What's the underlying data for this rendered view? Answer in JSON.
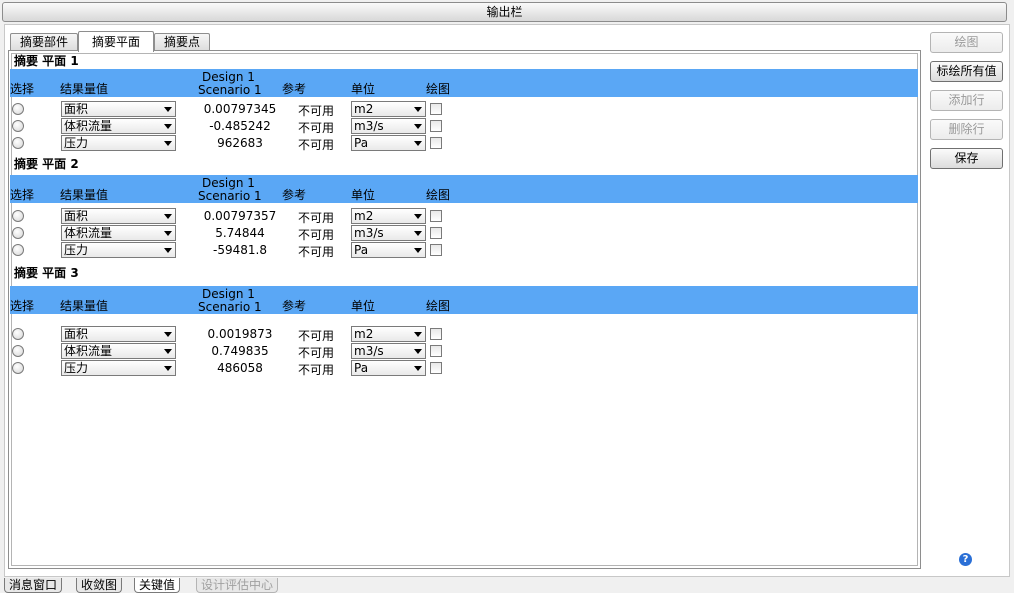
{
  "window": {
    "title": "输出栏"
  },
  "tabs": [
    {
      "label": "摘要部件"
    },
    {
      "label": "摘要平面"
    },
    {
      "label": "摘要点"
    }
  ],
  "columns": {
    "select": "选择",
    "quantity": "结果量值",
    "design_line1": "Design 1",
    "design_line2": "Scenario 1",
    "reference": "参考",
    "unit": "单位",
    "plot": "绘图"
  },
  "sections": [
    {
      "title": "摘要 平面 1",
      "rows": [
        {
          "quantity": "面积",
          "value": "0.00797345",
          "reference": "不可用",
          "unit": "m2"
        },
        {
          "quantity": "体积流量",
          "value": "-0.485242",
          "reference": "不可用",
          "unit": "m3/s"
        },
        {
          "quantity": "压力",
          "value": "962683",
          "reference": "不可用",
          "unit": "Pa"
        }
      ]
    },
    {
      "title": "摘要 平面 2",
      "rows": [
        {
          "quantity": "面积",
          "value": "0.00797357",
          "reference": "不可用",
          "unit": "m2"
        },
        {
          "quantity": "体积流量",
          "value": "5.74844",
          "reference": "不可用",
          "unit": "m3/s"
        },
        {
          "quantity": "压力",
          "value": "-59481.8",
          "reference": "不可用",
          "unit": "Pa"
        }
      ]
    },
    {
      "title": "摘要 平面 3",
      "rows": [
        {
          "quantity": "面积",
          "value": "0.0019873",
          "reference": "不可用",
          "unit": "m2"
        },
        {
          "quantity": "体积流量",
          "value": "0.749835",
          "reference": "不可用",
          "unit": "m3/s"
        },
        {
          "quantity": "压力",
          "value": "486058",
          "reference": "不可用",
          "unit": "Pa"
        }
      ]
    }
  ],
  "buttons": {
    "plot": "绘图",
    "label_all": "标绘所有值",
    "add_row": "添加行",
    "delete_row": "删除行",
    "save": "保存"
  },
  "help_icon": "?",
  "bottom_tabs": [
    {
      "label": "消息窗口"
    },
    {
      "label": "收敛图"
    },
    {
      "label": "关键值"
    },
    {
      "label": "设计评估中心"
    }
  ],
  "colors": {
    "header_bg": "#5aa7f5"
  }
}
